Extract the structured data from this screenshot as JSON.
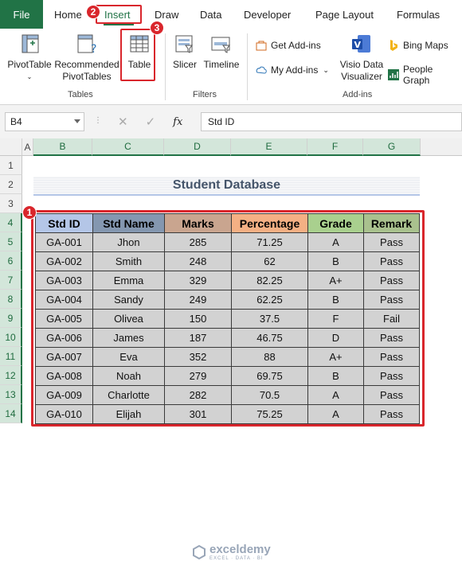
{
  "tabs": {
    "file": "File",
    "items": [
      "Home",
      "Insert",
      "Draw",
      "Data",
      "Developer",
      "Page Layout",
      "Formulas"
    ]
  },
  "ribbon": {
    "pivottable": "PivotTable",
    "recommended_pivot_1": "Recommended",
    "recommended_pivot_2": "PivotTables",
    "table": "Table",
    "slicer": "Slicer",
    "timeline": "Timeline",
    "get_addins": "Get Add-ins",
    "my_addins": "My Add-ins",
    "visio_1": "Visio Data",
    "visio_2": "Visualizer",
    "bing_maps": "Bing Maps",
    "people_graph": "People Graph",
    "group_tables": "Tables",
    "group_filters": "Filters",
    "group_addins": "Add-ins"
  },
  "formula_bar": {
    "name_box": "B4",
    "fx": "fx",
    "content": "Std ID"
  },
  "columns": [
    "A",
    "B",
    "C",
    "D",
    "E",
    "F",
    "G"
  ],
  "rows": [
    "1",
    "2",
    "3",
    "4",
    "5",
    "6",
    "7",
    "8",
    "9",
    "10",
    "11",
    "12",
    "13",
    "14"
  ],
  "sheet": {
    "title": "Student Database",
    "headers": [
      "Std ID",
      "Std Name",
      "Marks",
      "Percentage",
      "Grade",
      "Remark"
    ],
    "header_colors": [
      "#b4c6e7",
      "#8497b0",
      "#c9a58f",
      "#f4b084",
      "#a9d08e",
      "#a9c18e"
    ],
    "data": [
      [
        "GA-001",
        "Jhon",
        "285",
        "71.25",
        "A",
        "Pass"
      ],
      [
        "GA-002",
        "Smith",
        "248",
        "62",
        "B",
        "Pass"
      ],
      [
        "GA-003",
        "Emma",
        "329",
        "82.25",
        "A+",
        "Pass"
      ],
      [
        "GA-004",
        "Sandy",
        "249",
        "62.25",
        "B",
        "Pass"
      ],
      [
        "GA-005",
        "Olivea",
        "150",
        "37.5",
        "F",
        "Fail"
      ],
      [
        "GA-006",
        "James",
        "187",
        "46.75",
        "D",
        "Pass"
      ],
      [
        "GA-007",
        "Eva",
        "352",
        "88",
        "A+",
        "Pass"
      ],
      [
        "GA-008",
        "Noah",
        "279",
        "69.75",
        "B",
        "Pass"
      ],
      [
        "GA-009",
        "Charlotte",
        "282",
        "70.5",
        "A",
        "Pass"
      ],
      [
        "GA-010",
        "Elijah",
        "301",
        "75.25",
        "A",
        "Pass"
      ]
    ]
  },
  "badges": [
    "1",
    "2",
    "3"
  ],
  "watermark": {
    "name": "exceldemy",
    "tagline": "EXCEL · DATA · BI"
  },
  "colors": {
    "accent": "#217346",
    "highlight": "#d9262c"
  }
}
